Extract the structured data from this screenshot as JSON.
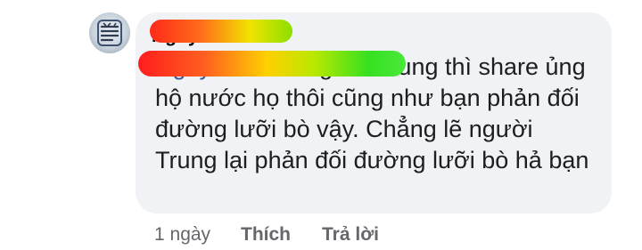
{
  "comment": {
    "author": "Nguyễn",
    "mention": "Nguyễn Thảo",
    "text_after_mention": " người Trung thì share ủng hộ nước họ thôi cũng như bạn phản đối đường lưỡi bò vậy. Chẳng lẽ người Trung lại phản đối đường lưỡi bò hả bạn",
    "time": "1 ngày",
    "like_label": "Thích",
    "reply_label": "Trả lời"
  },
  "colors": {
    "bubble": "#f0f2f5",
    "text": "#1c1e21",
    "mention": "#385898",
    "meta": "#65676b"
  }
}
